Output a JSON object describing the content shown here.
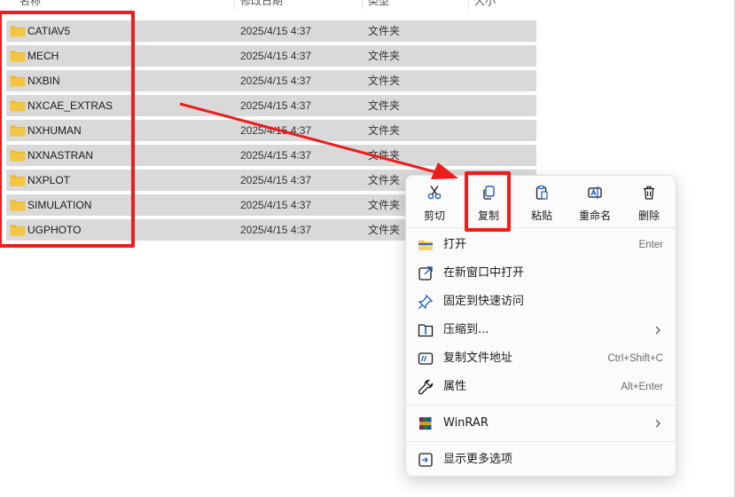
{
  "columns": {
    "name": "名称",
    "modified": "修改日期",
    "type": "类型",
    "size": "大小"
  },
  "files": [
    {
      "name": "CATIAV5",
      "date": "2025/4/15 4:37",
      "type": "文件夹"
    },
    {
      "name": "MECH",
      "date": "2025/4/15 4:37",
      "type": "文件夹"
    },
    {
      "name": "NXBIN",
      "date": "2025/4/15 4:37",
      "type": "文件夹"
    },
    {
      "name": "NXCAE_EXTRAS",
      "date": "2025/4/15 4:37",
      "type": "文件夹"
    },
    {
      "name": "NXHUMAN",
      "date": "2025/4/15 4:37",
      "type": "文件夹"
    },
    {
      "name": "NXNASTRAN",
      "date": "2025/4/15 4:37",
      "type": "文件夹"
    },
    {
      "name": "NXPLOT",
      "date": "2025/4/15 4:37",
      "type": "文件夹"
    },
    {
      "name": "SIMULATION",
      "date": "2025/4/15 4:37",
      "type": "文件夹"
    },
    {
      "name": "UGPHOTO",
      "date": "2025/4/15 4:37",
      "type": "文件夹"
    }
  ],
  "context_menu": {
    "quick_actions": [
      {
        "label": "剪切",
        "icon": "scissors-icon"
      },
      {
        "label": "复制",
        "icon": "copy-icon"
      },
      {
        "label": "粘贴",
        "icon": "clipboard-icon"
      },
      {
        "label": "重命名",
        "icon": "rename-icon"
      },
      {
        "label": "删除",
        "icon": "trash-icon"
      }
    ],
    "items": [
      {
        "label": "打开",
        "shortcut": "Enter",
        "icon": "folder-open-icon"
      },
      {
        "label": "在新窗口中打开",
        "shortcut": "",
        "icon": "open-new-window-icon"
      },
      {
        "label": "固定到快速访问",
        "shortcut": "",
        "icon": "pin-icon"
      },
      {
        "label": "压缩到...",
        "shortcut": "",
        "icon": "compress-icon",
        "submenu": true
      },
      {
        "label": "复制文件地址",
        "shortcut": "Ctrl+Shift+C",
        "icon": "copy-path-icon"
      },
      {
        "label": "属性",
        "shortcut": "Alt+Enter",
        "icon": "wrench-icon"
      },
      {
        "label": "WinRAR",
        "shortcut": "",
        "icon": "winrar-icon",
        "submenu": true
      },
      {
        "label": "显示更多选项",
        "shortcut": "",
        "icon": "more-options-icon"
      }
    ]
  },
  "colors": {
    "annotation_red": "#ee1c1c",
    "row_selected": "#d9d9d9",
    "folder_yellow": "#f4c542"
  }
}
